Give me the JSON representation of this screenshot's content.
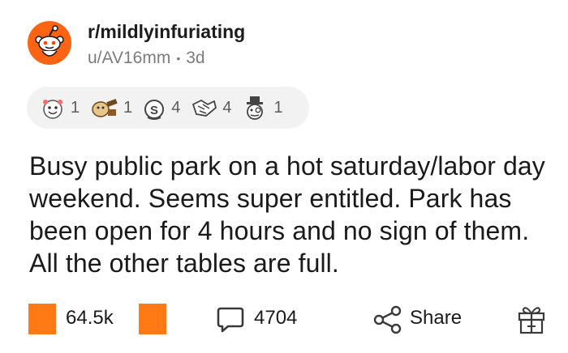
{
  "post": {
    "subreddit": "r/mildlyinfuriating",
    "author": "u/AV16mm",
    "separator": "•",
    "age": "3d",
    "body": "Busy public park on a hot saturday/labor day weekend. Seems super entitled. Park has been open for 4 hours and no sign of them. All the other tables are full."
  },
  "awards": [
    {
      "icon": "wholesome-award-icon",
      "count": "1"
    },
    {
      "icon": "doge-award-icon",
      "count": "1"
    },
    {
      "icon": "silver-coin-award-icon",
      "count": "4"
    },
    {
      "icon": "bro-hug-award-icon",
      "count": "4"
    },
    {
      "icon": "gentleman-award-icon",
      "count": "1"
    }
  ],
  "actions": {
    "score": "64.5k",
    "comments": "4704",
    "share_label": "Share",
    "upvote_icon": "upvote-icon",
    "downvote_icon": "downvote-icon",
    "comment_icon": "comment-bubble-icon",
    "share_icon": "share-icon",
    "gift_icon": "gift-award-icon"
  },
  "colors": {
    "accent": "#ff7a14",
    "avatar": "#ff6314",
    "awards_bg": "#f2f2f3",
    "meta_text": "#7c7c7c"
  }
}
